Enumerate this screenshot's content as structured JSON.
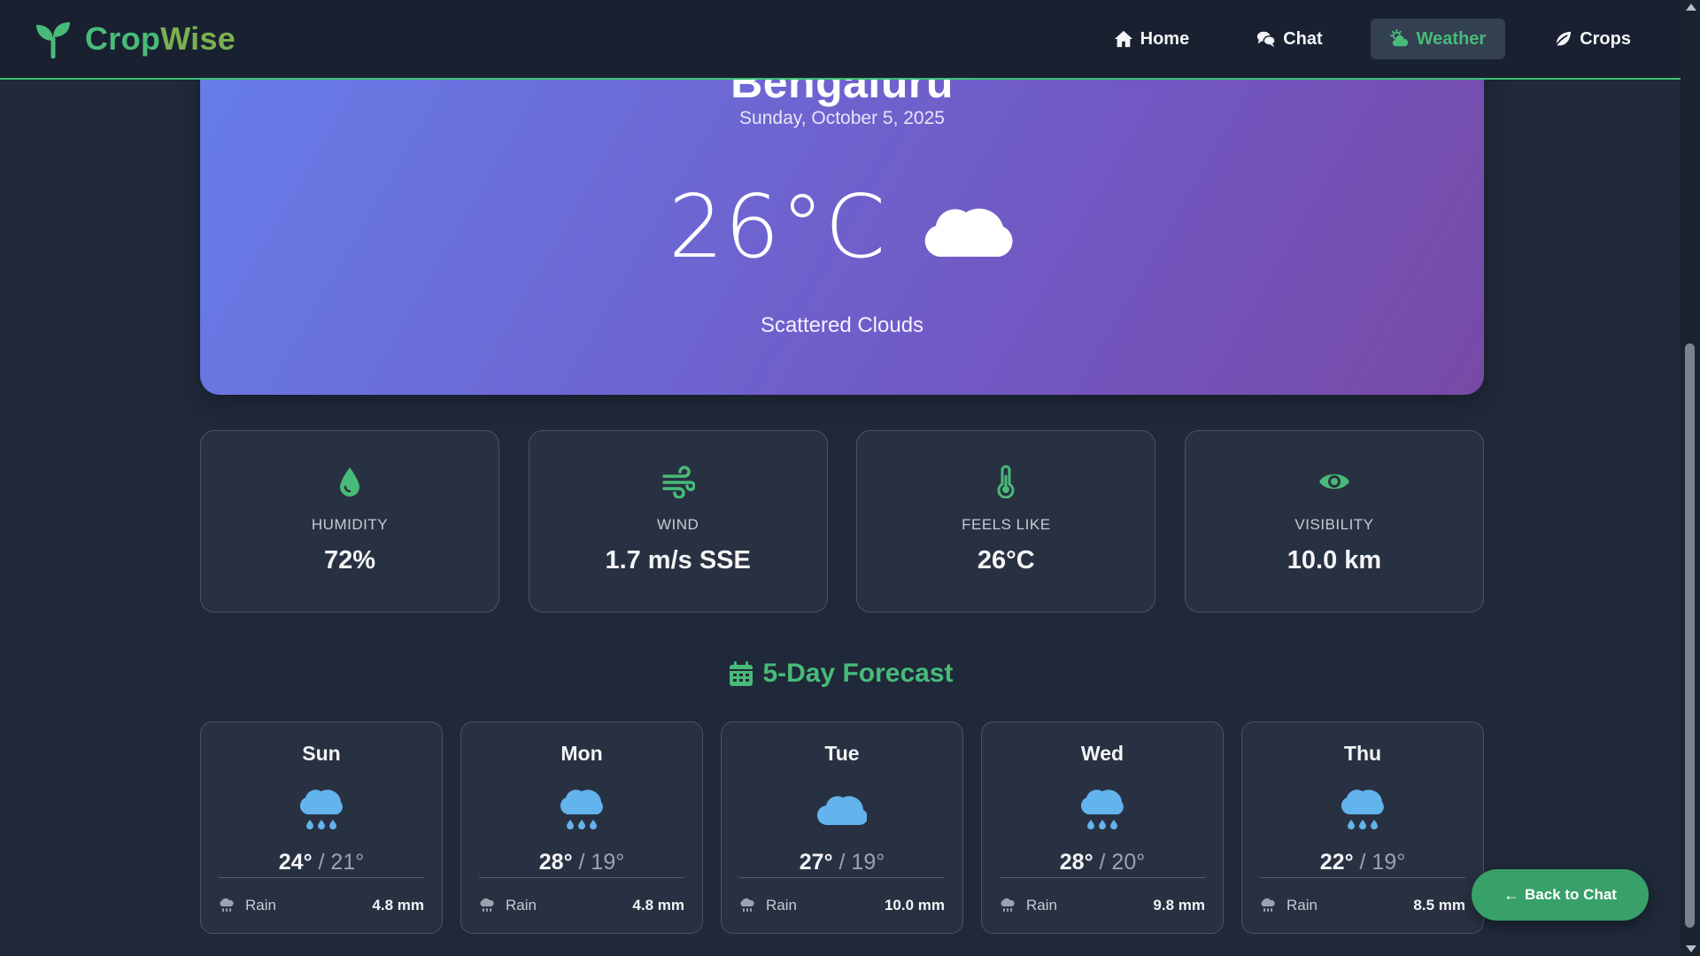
{
  "app": {
    "name_part1": "Crop",
    "name_part2": "Wise",
    "logo_icon": "sprout-icon"
  },
  "nav": {
    "items": [
      {
        "label": "Home",
        "icon": "home-icon",
        "active": false
      },
      {
        "label": "Chat",
        "icon": "chat-icon",
        "active": false
      },
      {
        "label": "Weather",
        "icon": "cloud-sun-icon",
        "active": true
      },
      {
        "label": "Crops",
        "icon": "leaf-icon",
        "active": false
      }
    ]
  },
  "current": {
    "city": "Bengaluru",
    "date": "Sunday, October 5, 2025",
    "temperature": "26°C",
    "condition": "Scattered Clouds",
    "icon": "cloud-icon"
  },
  "stats": [
    {
      "label": "HUMIDITY",
      "value": "72%",
      "icon": "droplet-icon"
    },
    {
      "label": "WIND",
      "value": "1.7 m/s SSE",
      "icon": "wind-icon"
    },
    {
      "label": "FEELS LIKE",
      "value": "26°C",
      "icon": "thermometer-icon"
    },
    {
      "label": "VISIBILITY",
      "value": "10.0 km",
      "icon": "eye-icon"
    }
  ],
  "forecast": {
    "title": "5-Day Forecast",
    "days": [
      {
        "day": "Sun",
        "high": "24°",
        "low": "21°",
        "icon": "cloud-rain-icon",
        "rain_label": "Rain",
        "rain": "4.8 mm"
      },
      {
        "day": "Mon",
        "high": "28°",
        "low": "19°",
        "icon": "cloud-rain-icon",
        "rain_label": "Rain",
        "rain": "4.8 mm"
      },
      {
        "day": "Tue",
        "high": "27°",
        "low": "19°",
        "icon": "cloud-icon",
        "rain_label": "Rain",
        "rain": "10.0 mm"
      },
      {
        "day": "Wed",
        "high": "28°",
        "low": "20°",
        "icon": "cloud-rain-icon",
        "rain_label": "Rain",
        "rain": "9.8 mm"
      },
      {
        "day": "Thu",
        "high": "22°",
        "low": "19°",
        "icon": "cloud-rain-icon",
        "rain_label": "Rain",
        "rain": "8.5 mm"
      }
    ]
  },
  "back_button": {
    "label": "Back to Chat",
    "icon": "arrow-left-icon"
  },
  "colors": {
    "accent": "#48bb78",
    "background": "#1f2939",
    "card": "#283142",
    "hero_start": "#667eea",
    "hero_end": "#764ba2",
    "rain_icon": "#63b3ed"
  }
}
